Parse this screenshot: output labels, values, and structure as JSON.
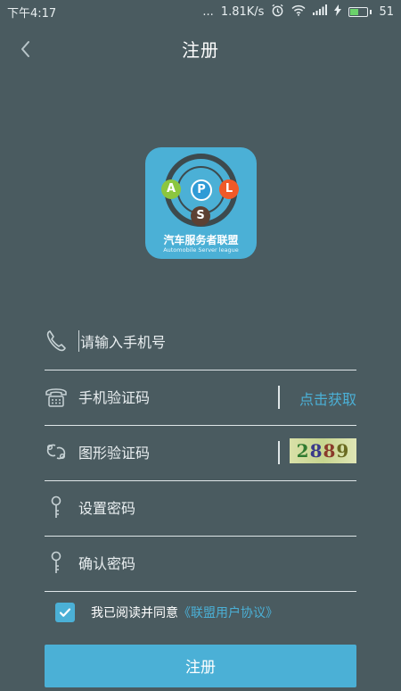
{
  "status_bar": {
    "time": "下午4:17",
    "dots": "...",
    "speed": "1.81K/s",
    "battery_level": "51",
    "battery_fraction": 0.51,
    "battery_color": "#6bd16b"
  },
  "header": {
    "title": "注册"
  },
  "logo": {
    "letters": [
      "A",
      "P",
      "L",
      "S"
    ],
    "name_cn": "汽车服务者联盟",
    "name_en": "Automobile Server league"
  },
  "form": {
    "phone_placeholder": "请输入手机号",
    "sms_code_placeholder": "手机验证码",
    "get_code_label": "点击获取",
    "captcha_placeholder": "图形验证码",
    "captcha_digits": [
      "2",
      "8",
      "8",
      "9"
    ],
    "password_placeholder": "设置密码",
    "confirm_password_placeholder": "确认密码"
  },
  "agreement": {
    "checked": true,
    "text": "我已阅读并同意",
    "link": "《联盟用户协议》"
  },
  "register_button": "注册",
  "colors": {
    "background": "#4a5b60",
    "accent": "#4bb0d6"
  }
}
